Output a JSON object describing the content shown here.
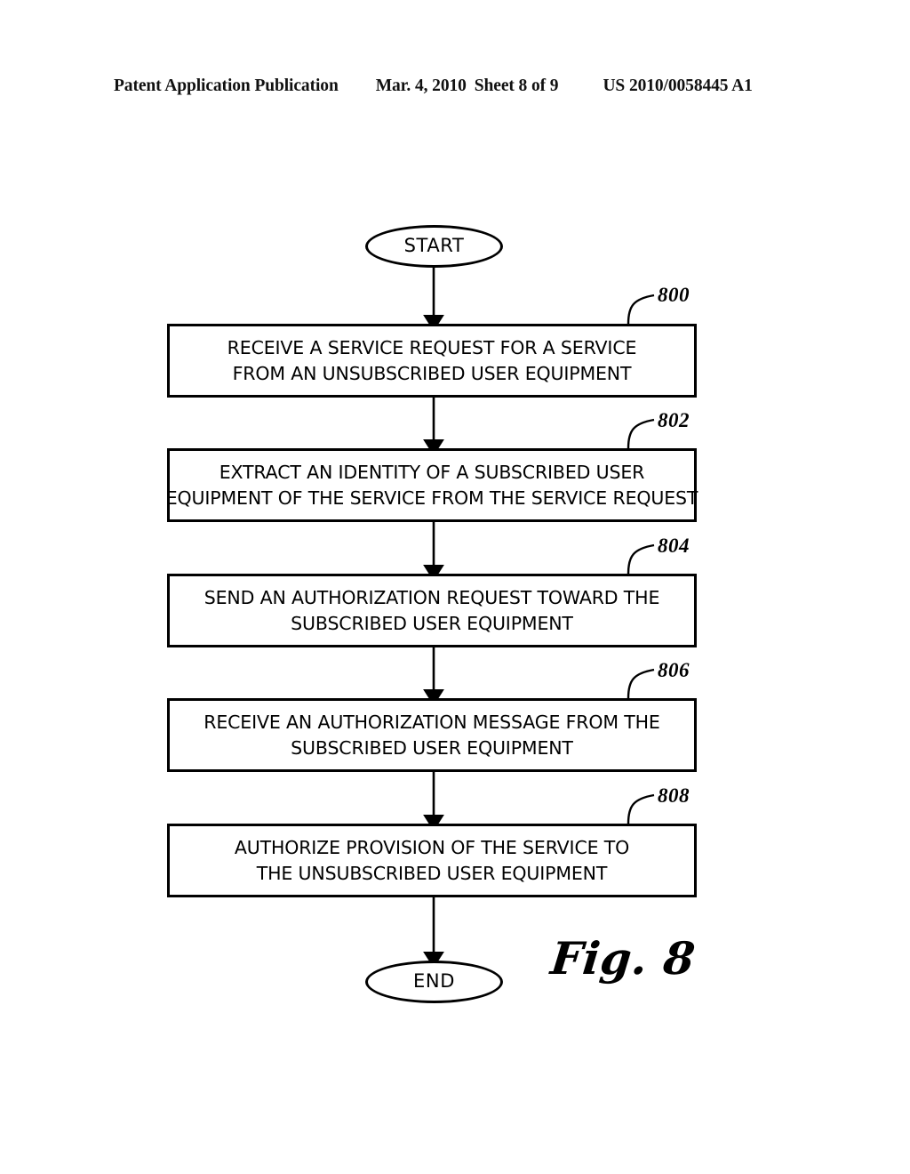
{
  "header": {
    "publication": "Patent Application Publication",
    "date": "Mar. 4, 2010",
    "sheet": "Sheet 8 of 9",
    "patent_number": "US 2010/0058445 A1"
  },
  "figure": {
    "caption": "Fig. 8",
    "type": "flowchart",
    "start_label": "START",
    "end_label": "END",
    "steps": [
      {
        "ref": "800",
        "line1": "RECEIVE A SERVICE REQUEST FOR A SERVICE",
        "line2": "FROM AN UNSUBSCRIBED USER EQUIPMENT"
      },
      {
        "ref": "802",
        "line1": "EXTRACT AN IDENTITY OF A SUBSCRIBED USER",
        "line2": "EQUIPMENT OF THE SERVICE FROM THE SERVICE REQUEST"
      },
      {
        "ref": "804",
        "line1": "SEND AN AUTHORIZATION REQUEST TOWARD THE",
        "line2": "SUBSCRIBED USER EQUIPMENT"
      },
      {
        "ref": "806",
        "line1": "RECEIVE AN AUTHORIZATION MESSAGE FROM THE",
        "line2": "SUBSCRIBED USER EQUIPMENT"
      },
      {
        "ref": "808",
        "line1": "AUTHORIZE PROVISION OF THE SERVICE TO",
        "line2": "THE UNSUBSCRIBED USER EQUIPMENT"
      }
    ]
  },
  "colors": {
    "ink": "#000000",
    "page": "#ffffff"
  }
}
